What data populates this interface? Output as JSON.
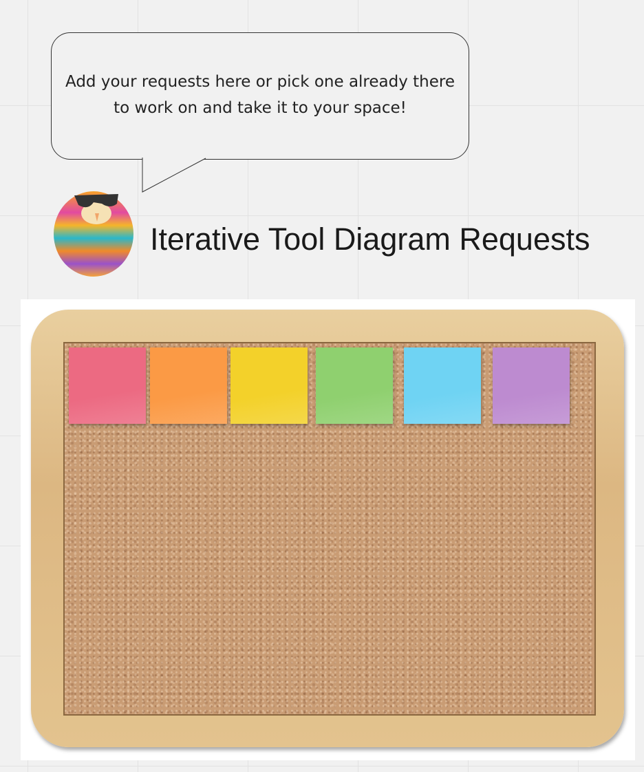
{
  "bubble": {
    "text": "Add your requests here or pick one already there to work on and take it to your space!"
  },
  "title": "Iterative Tool Diagram Requests",
  "mascot": {
    "icon": "rainbow-fluffy-owl-with-sunglasses"
  },
  "board": {
    "sticky_notes": [
      {
        "color": "#ec6a82"
      },
      {
        "color": "#fb9a45"
      },
      {
        "color": "#f3d12a"
      },
      {
        "color": "#8fd06f"
      },
      {
        "color": "#6fd3f3"
      },
      {
        "color": "#bd8bd0"
      }
    ]
  }
}
